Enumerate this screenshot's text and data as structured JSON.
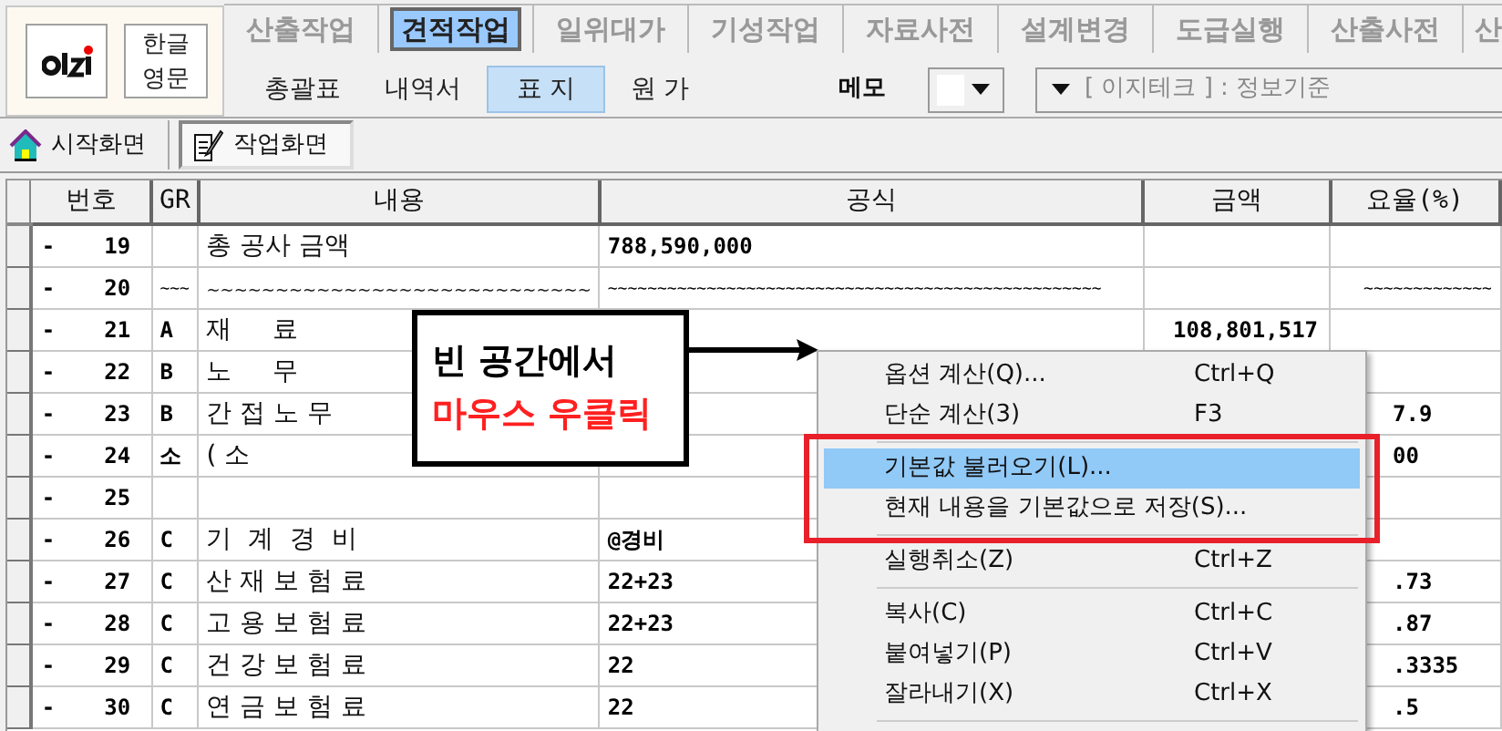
{
  "language_button": {
    "lines": [
      "한글",
      "영문"
    ]
  },
  "tabs": [
    {
      "label": "산출작업",
      "selected": false
    },
    {
      "label": "견적작업",
      "selected": true
    },
    {
      "label": "일위대가",
      "selected": false
    },
    {
      "label": "기성작업",
      "selected": false
    },
    {
      "label": "자료사전",
      "selected": false
    },
    {
      "label": "설계변경",
      "selected": false
    },
    {
      "label": "도급실행",
      "selected": false
    },
    {
      "label": "산출사전",
      "selected": false
    },
    {
      "label": "산",
      "selected": false
    }
  ],
  "subtabs": [
    {
      "label": "총괄표",
      "selected": false
    },
    {
      "label": "내역서",
      "selected": false
    },
    {
      "label": "표 지",
      "selected": true
    },
    {
      "label": "원 가",
      "selected": false
    }
  ],
  "memo": {
    "label": "메모"
  },
  "standard_combo": {
    "value": "[ 이지테크 ] : 정보기준"
  },
  "doc_tabs": [
    {
      "label": "시작화면",
      "selected": false,
      "kind": "home"
    },
    {
      "label": "작업화면",
      "selected": true,
      "kind": "work"
    }
  ],
  "table": {
    "columns": [
      "번호",
      "GR",
      "내용",
      "공식",
      "금액",
      "요율(%)"
    ],
    "rows": [
      {
        "marker": "-",
        "number": "19",
        "content": "총 공사 금액",
        "formula": "788,590,000"
      },
      {
        "marker": "-",
        "number": "20",
        "gr": "~~~",
        "content": "~~~~~~~~~~~~~~~~~~~~~~~~~~~~",
        "formula": "~~~~~~~~~~~~~~~~~~~~~~~~~~~~~~~~~~~~~~~~~~~~~~~~~~",
        "rate": "~~~~~~~~~~~~~"
      },
      {
        "marker": "-",
        "number": "21",
        "gr": "A",
        "content": "재     료",
        "amount": "108,801,517"
      },
      {
        "marker": "-",
        "number": "22",
        "gr": "B",
        "content": "노     무"
      },
      {
        "marker": "-",
        "number": "23",
        "gr": "B",
        "content": "간 접 노 무",
        "rate": "7.9"
      },
      {
        "marker": "-",
        "number": "24",
        "gr": "소",
        "content": "( 소",
        "rate": "00"
      },
      {
        "marker": "-",
        "number": "25"
      },
      {
        "marker": "-",
        "number": "26",
        "gr": "C",
        "content": "기  계  경  비",
        "formula": "@경비"
      },
      {
        "marker": "-",
        "number": "27",
        "gr": "C",
        "content": "산 재 보 험 료",
        "formula": "22+23",
        "rate": ".73"
      },
      {
        "marker": "-",
        "number": "28",
        "gr": "C",
        "content": "고 용 보 험 료",
        "formula": "22+23",
        "rate": ".87"
      },
      {
        "marker": "-",
        "number": "29",
        "gr": "C",
        "content": "건 강 보 험 료",
        "formula": "22",
        "rate": ".3335"
      },
      {
        "marker": "-",
        "number": "30",
        "gr": "C",
        "content": "연 금 보 험 료",
        "formula": "22",
        "rate": ".5"
      }
    ]
  },
  "callout": {
    "lines": [
      {
        "text": "빈 공간에서",
        "color": "#000000"
      },
      {
        "text": "마우스 우클릭",
        "color": "#ff2020"
      }
    ]
  },
  "context_menu": {
    "items": [
      {
        "kind": "item",
        "label": "옵션 계산(Q)...",
        "shortcut": "Ctrl+Q",
        "selected": false
      },
      {
        "kind": "item",
        "label": "단순 계산(3)",
        "shortcut": "F3",
        "selected": false
      },
      {
        "kind": "separator"
      },
      {
        "kind": "item",
        "label": "기본값 불러오기(L)...",
        "selected": true
      },
      {
        "kind": "item",
        "label": "현재 내용을 기본값으로 저장(S)...",
        "selected": false
      },
      {
        "kind": "separator"
      },
      {
        "kind": "item",
        "label": "실행취소(Z)",
        "shortcut": "Ctrl+Z",
        "selected": false
      },
      {
        "kind": "separator"
      },
      {
        "kind": "item",
        "label": "복사(C)",
        "shortcut": "Ctrl+C",
        "selected": false
      },
      {
        "kind": "item",
        "label": "붙여넣기(P)",
        "shortcut": "Ctrl+V",
        "selected": false
      },
      {
        "kind": "item",
        "label": "잘라내기(X)",
        "shortcut": "Ctrl+X",
        "selected": false
      },
      {
        "kind": "separator"
      }
    ]
  }
}
